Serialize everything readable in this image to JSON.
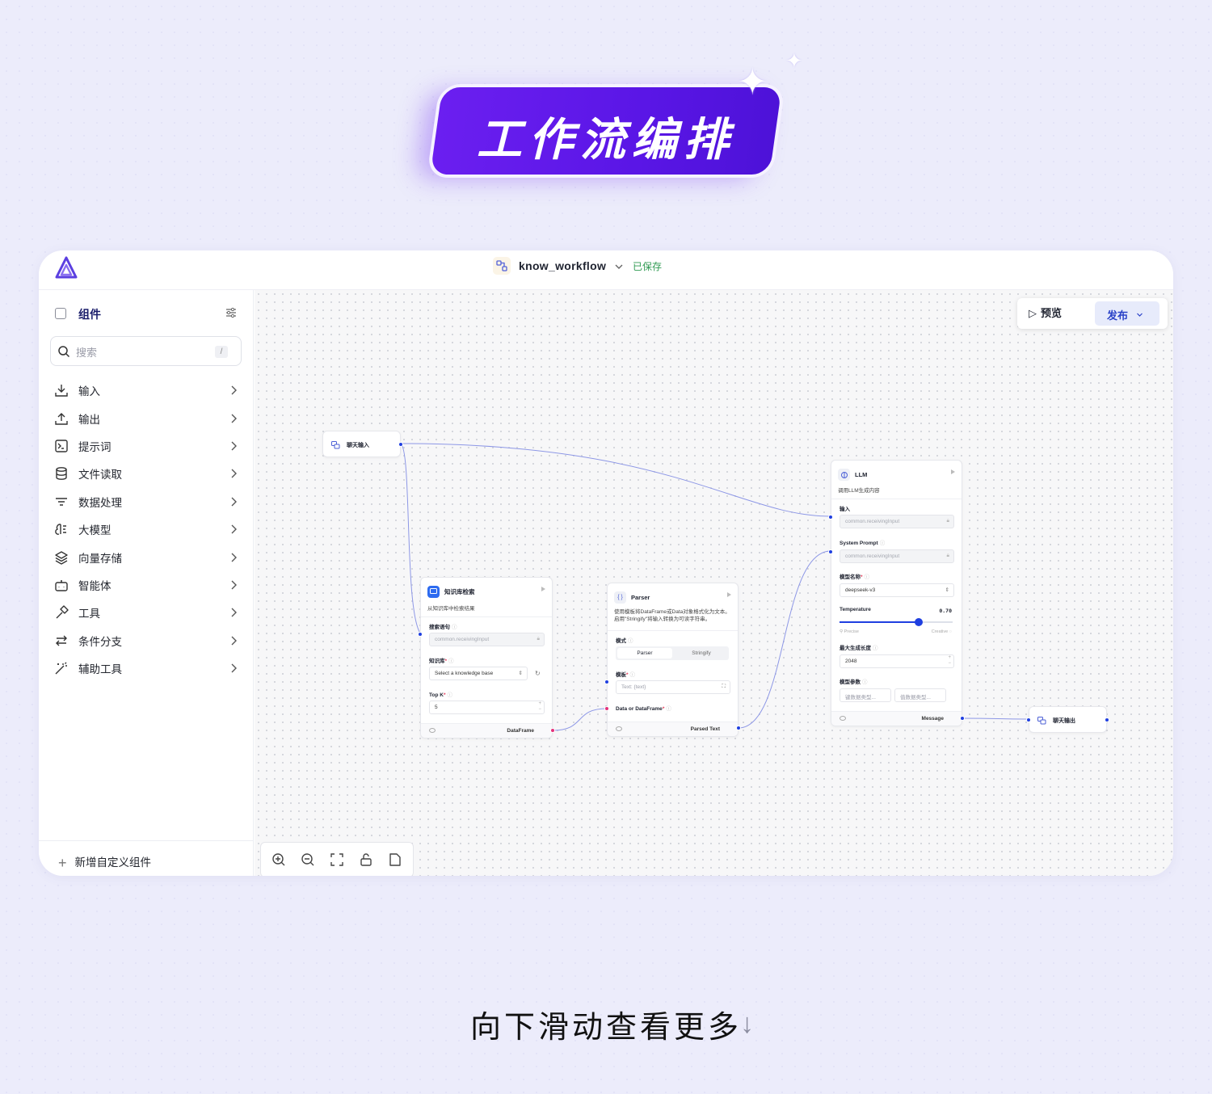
{
  "banner": {
    "title": "工作流编排"
  },
  "app": {
    "workflow_name": "know_workflow",
    "status": "已保存"
  },
  "sidebar": {
    "title": "组件",
    "search_placeholder": "搜索",
    "search_shortcut": "/",
    "items": [
      {
        "label": "输入",
        "icon": "download-icon"
      },
      {
        "label": "输出",
        "icon": "upload-icon"
      },
      {
        "label": "提示词",
        "icon": "terminal-icon"
      },
      {
        "label": "文件读取",
        "icon": "database-icon"
      },
      {
        "label": "数据处理",
        "icon": "filter-icon"
      },
      {
        "label": "大模型",
        "icon": "brain-icon"
      },
      {
        "label": "向量存储",
        "icon": "layers-icon"
      },
      {
        "label": "智能体",
        "icon": "bot-icon"
      },
      {
        "label": "工具",
        "icon": "hammer-icon"
      },
      {
        "label": "条件分支",
        "icon": "arrows-icon"
      },
      {
        "label": "辅助工具",
        "icon": "wand-icon"
      }
    ],
    "add_custom": "新增自定义组件"
  },
  "toolbar": {
    "preview": "预览",
    "publish": "发布"
  },
  "nodes": {
    "chat_input": {
      "title": "聊天输入"
    },
    "knowledge": {
      "title": "知识库检索",
      "desc": "从知识库中检索结果",
      "query_label": "搜索语句",
      "query_value": "common.receivingInput",
      "kb_label": "知识库",
      "kb_placeholder": "Select a knowledge base",
      "topk_label": "Top K",
      "topk_value": "5",
      "output": "DataFrame"
    },
    "parser": {
      "title": "Parser",
      "desc": "使用模板将DataFrame或Data对象格式化为文本。启用\"Stringify\"将输入转换为可读字符串。",
      "mode_label": "模式",
      "mode_on": "Parser",
      "mode_off": "Stringify",
      "template_label": "模板",
      "template_placeholder": "Text: {text}",
      "data_label": "Data or DataFrame",
      "output": "Parsed Text"
    },
    "llm": {
      "title": "LLM",
      "desc": "调用LLM生成内容",
      "input_label": "输入",
      "input_value": "common.receivingInput",
      "system_label": "System Prompt",
      "system_value": "common.receivingInput",
      "model_label": "模型名称",
      "model_value": "deepseek-v3",
      "temp_label": "Temperature",
      "temp_value": "0.70",
      "temp_fraction": 0.7,
      "precise": "Precise",
      "creative": "Creative",
      "maxlen_label": "最大生成长度",
      "maxlen_value": "2048",
      "params_label": "模型参数",
      "key_placeholder": "键数据类型...",
      "val_placeholder": "值数据类型...",
      "output": "Message"
    },
    "chat_output": {
      "title": "聊天输出"
    }
  },
  "footer": {
    "scroll_hint": "向下滑动查看更多",
    "arrow": "↓"
  },
  "colors": {
    "accent": "#1f3fe0",
    "banner": "#5a16e6",
    "saved": "#2f9a52"
  }
}
